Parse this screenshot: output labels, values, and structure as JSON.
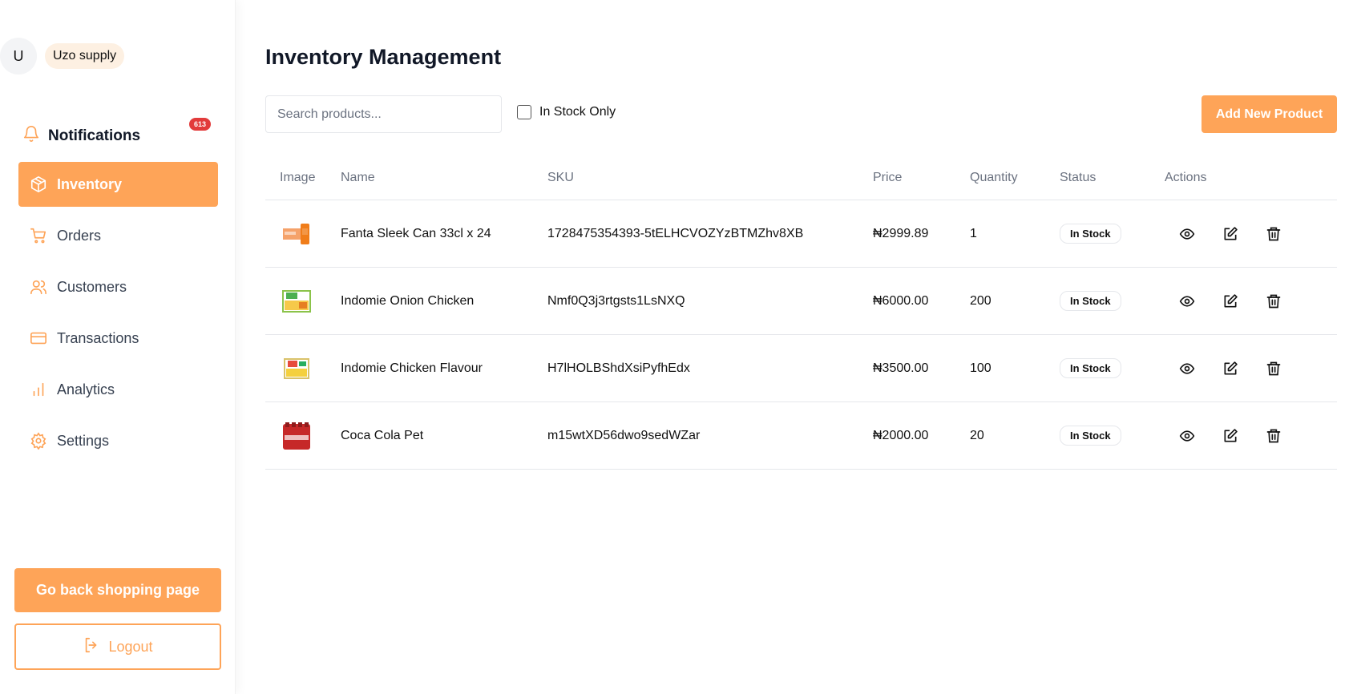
{
  "user": {
    "initial": "U",
    "store_name": "Uzo supply"
  },
  "notifications": {
    "label": "Notifications",
    "count": "613"
  },
  "nav": {
    "items": [
      {
        "label": "Inventory",
        "icon": "box-icon",
        "active": true
      },
      {
        "label": "Orders",
        "icon": "cart-icon"
      },
      {
        "label": "Customers",
        "icon": "users-icon"
      },
      {
        "label": "Transactions",
        "icon": "card-icon"
      },
      {
        "label": "Analytics",
        "icon": "bar-chart-icon"
      },
      {
        "label": "Settings",
        "icon": "gear-icon"
      }
    ]
  },
  "sidebar_actions": {
    "shop_label": "Go back shopping page",
    "logout_label": "Logout"
  },
  "page": {
    "title": "Inventory Management"
  },
  "toolbar": {
    "search_placeholder": "Search products...",
    "filter_label": "In Stock Only",
    "add_label": "Add New Product"
  },
  "table": {
    "headers": [
      "Image",
      "Name",
      "SKU",
      "Price",
      "Quantity",
      "Status",
      "Actions"
    ],
    "rows": [
      {
        "name": "Fanta Sleek Can 33cl x 24",
        "sku": "1728475354393-5tELHCVOZYzBTMZhv8XB",
        "price": "₦2999.89",
        "quantity": "1",
        "status": "In Stock",
        "image": "fanta-can-thumbnail"
      },
      {
        "name": "Indomie Onion Chicken",
        "sku": "Nmf0Q3j3rtgsts1LsNXQ",
        "price": "₦6000.00",
        "quantity": "200",
        "status": "In Stock",
        "image": "indomie-onion-thumbnail"
      },
      {
        "name": "Indomie Chicken Flavour",
        "sku": "H7lHOLBShdXsiPyfhEdx",
        "price": "₦3500.00",
        "quantity": "100",
        "status": "In Stock",
        "image": "indomie-chicken-thumbnail"
      },
      {
        "name": "Coca Cola Pet",
        "sku": "m15wtXD56dwo9sedWZar",
        "price": "₦2000.00",
        "quantity": "20",
        "status": "In Stock",
        "image": "coca-cola-thumbnail"
      }
    ]
  },
  "colors": {
    "accent": "#fea458",
    "badge": "#e23b3b"
  }
}
